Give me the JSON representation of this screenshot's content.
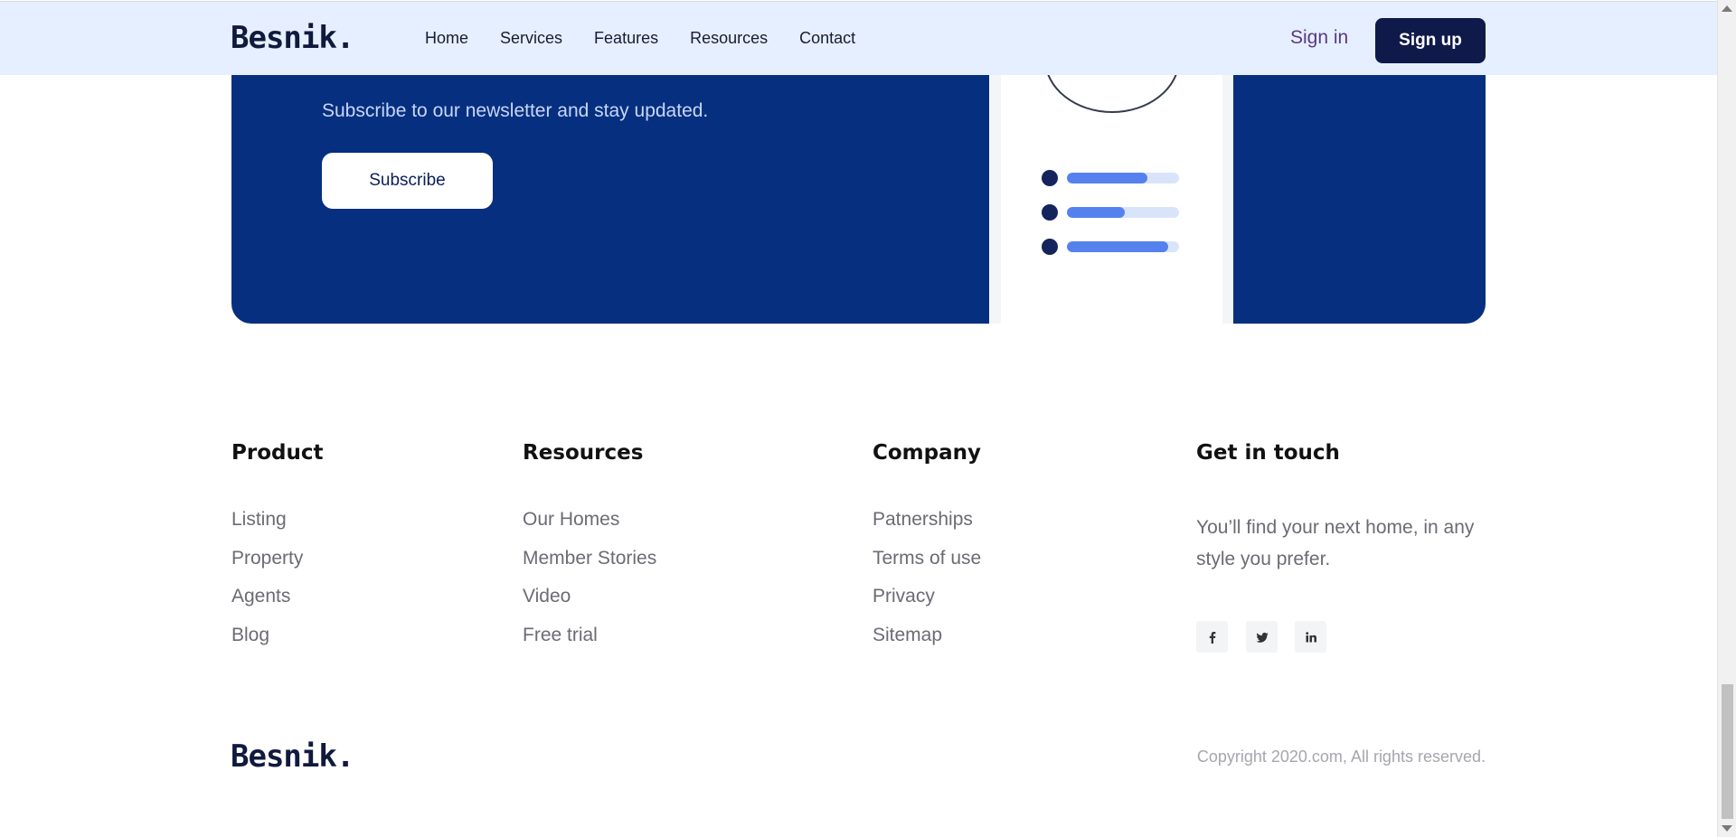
{
  "header": {
    "logo": "Besnik.",
    "nav": [
      "Home",
      "Services",
      "Features",
      "Resources",
      "Contact"
    ],
    "sign_in": "Sign in",
    "sign_up": "Sign up",
    "background": "#e5efff"
  },
  "banner": {
    "text": "Subscribe to our newsletter and stay updated.",
    "button": "Subscribe",
    "background": "#062f80",
    "progress_items": [
      0.72,
      0.52,
      0.9
    ]
  },
  "footer": {
    "columns": [
      {
        "title": "Product",
        "items": [
          "Listing",
          "Property",
          "Agents",
          "Blog"
        ]
      },
      {
        "title": "Resources",
        "items": [
          "Our Homes",
          "Member Stories",
          "Video",
          "Free trial"
        ]
      },
      {
        "title": "Company",
        "items": [
          "Patnerships",
          "Terms of use",
          "Privacy",
          "Sitemap"
        ]
      }
    ],
    "contact": {
      "title": "Get in touch",
      "text": "You’ll find your next home, in any style you prefer.",
      "social_icons": [
        "facebook-icon",
        "twitter-icon",
        "linkedin-icon"
      ]
    },
    "logo": "Besnik.",
    "copyright": "Copyright 2020.com, All rights reserved."
  }
}
